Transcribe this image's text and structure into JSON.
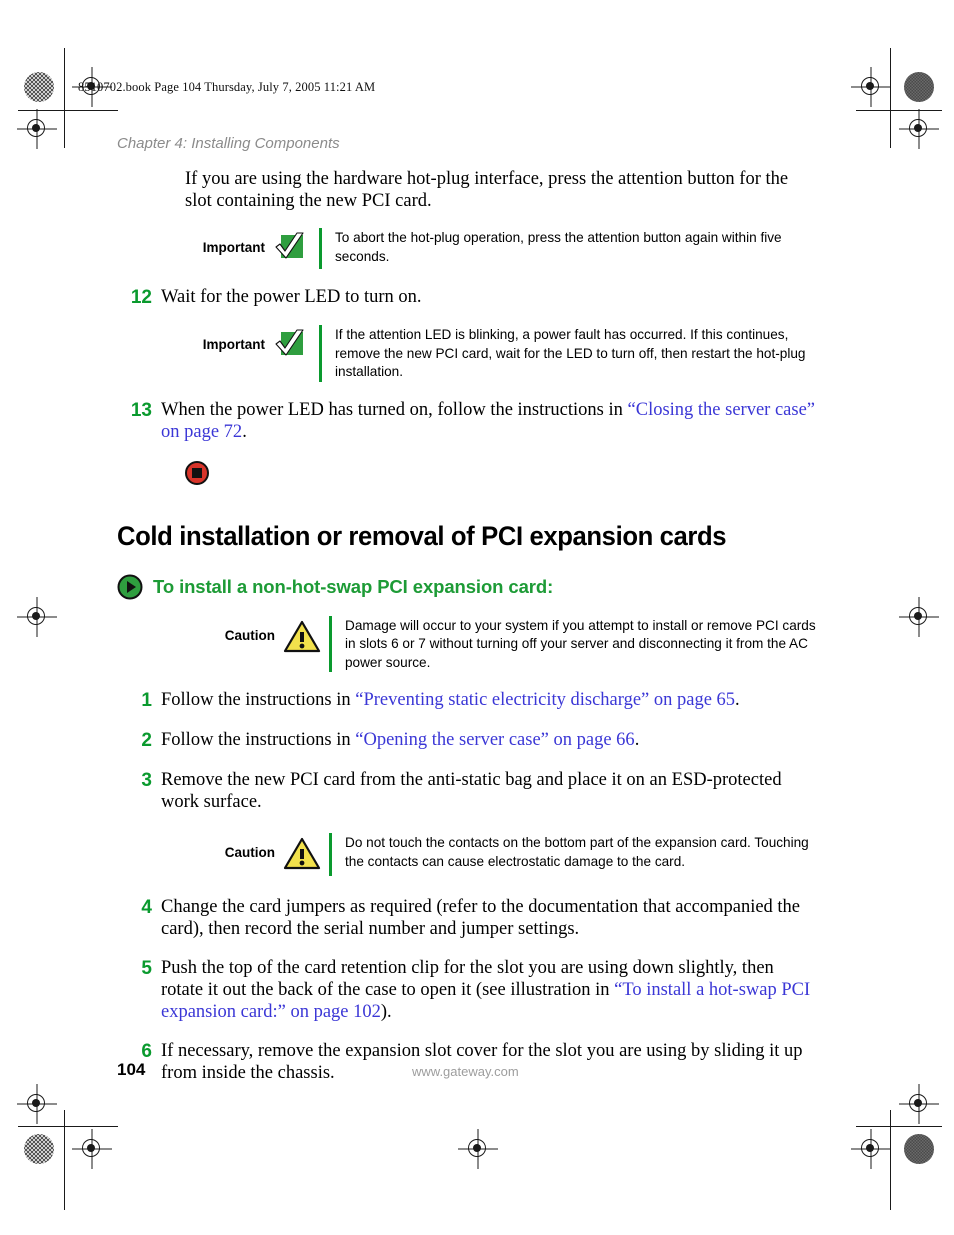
{
  "page": {
    "book_slug": "8510702.book  Page 104  Thursday, July 7, 2005  11:21 AM",
    "chapter_header": "Chapter 4: Installing Components",
    "page_number": "104",
    "website": "www.gateway.com",
    "accent_green": "#0a9a2e",
    "link_blue": "#3b37d6",
    "caution_yellow": "#f2e14c",
    "stop_red": "#d8342a"
  },
  "intro": {
    "text": "If you are using the hardware hot-plug interface, press the attention button for the slot containing the new PCI card."
  },
  "notes": [
    {
      "label": "Important",
      "icon": "important-check-icon",
      "text": "To abort the hot-plug operation, press the attention button again within five seconds."
    },
    {
      "label": "Important",
      "icon": "important-check-icon",
      "text": "If the attention LED is blinking, a power fault has occurred. If this continues, remove the new PCI card, wait for the LED to turn off, then restart the hot-plug installation."
    },
    {
      "label": "Caution",
      "icon": "caution-warning-icon",
      "text": "Damage will occur to your system if you attempt to install or remove PCI cards in slots 6 or 7 without turning off your server and disconnecting it from the AC power source."
    },
    {
      "label": "Caution",
      "icon": "caution-warning-icon",
      "text": "Do not touch the contacts on the bottom part of the expansion card. Touching the contacts can cause electrostatic damage to the card."
    }
  ],
  "steps_top": [
    {
      "number": "12",
      "parts": [
        {
          "type": "text",
          "value": "Wait for the power LED to turn on."
        }
      ]
    },
    {
      "number": "13",
      "parts": [
        {
          "type": "text",
          "value": "When the power LED has turned on, follow the instructions in "
        },
        {
          "type": "link",
          "value": "“Closing the server case” on page 72"
        },
        {
          "type": "text",
          "value": "."
        }
      ]
    }
  ],
  "heading": {
    "main": "Cold installation or removal of PCI expansion cards",
    "sub": "To install a non-hot-swap PCI expansion card:",
    "sub_icon": "green-play-bullet-icon"
  },
  "steps_bottom": [
    {
      "number": "1",
      "parts": [
        {
          "type": "text",
          "value": "Follow the instructions in "
        },
        {
          "type": "link",
          "value": "“Preventing static electricity discharge” on page 65"
        },
        {
          "type": "text",
          "value": "."
        }
      ]
    },
    {
      "number": "2",
      "parts": [
        {
          "type": "text",
          "value": "Follow the instructions in "
        },
        {
          "type": "link",
          "value": "“Opening the server case” on page 66"
        },
        {
          "type": "text",
          "value": "."
        }
      ]
    },
    {
      "number": "3",
      "parts": [
        {
          "type": "text",
          "value": "Remove the new PCI card from the anti-static bag and place it on an ESD-protected work surface."
        }
      ]
    },
    {
      "number": "4",
      "parts": [
        {
          "type": "text",
          "value": "Change the card jumpers as required (refer to the documentation that accompanied the card), then record the serial number and jumper settings."
        }
      ]
    },
    {
      "number": "5",
      "parts": [
        {
          "type": "text",
          "value": "Push the top of the card retention clip for the slot you are using down slightly, then rotate it out the back of the case to open it (see illustration in "
        },
        {
          "type": "link",
          "value": "“To install a hot-swap PCI expansion card:” on page 102"
        },
        {
          "type": "text",
          "value": ")."
        }
      ]
    },
    {
      "number": "6",
      "parts": [
        {
          "type": "text",
          "value": "If necessary, remove the expansion slot cover for the slot you are using by sliding it up from inside the chassis."
        }
      ]
    }
  ],
  "stop_marker": {
    "icon": "stop-square-icon"
  }
}
